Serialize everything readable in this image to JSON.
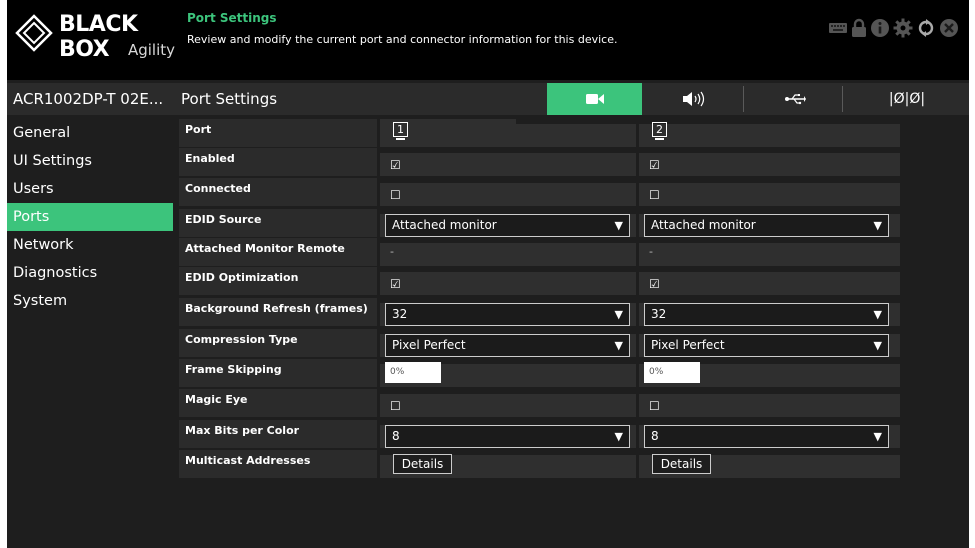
{
  "header": {
    "brand": "BLACK BOX",
    "product": "Agility",
    "title": "Port Settings",
    "description": "Review and modify the current port and connector information for this device.",
    "icons": [
      "keyboard-icon",
      "lock-icon",
      "info-icon",
      "settings-icon",
      "refresh-icon",
      "close-icon"
    ]
  },
  "device": {
    "name": "ACR1002DP-T 02E..."
  },
  "nav": {
    "items": [
      "General",
      "UI Settings",
      "Users",
      "Ports",
      "Network",
      "Diagnostics",
      "System"
    ],
    "active": "Ports"
  },
  "section": {
    "title": "Port Settings",
    "tabs": [
      {
        "icon": "video-camera-icon",
        "active": true
      },
      {
        "icon": "speaker-icon",
        "active": false
      },
      {
        "icon": "usb-icon",
        "active": false
      },
      {
        "icon": "serial-icon",
        "label": "|Ø|Ø|",
        "active": false
      }
    ]
  },
  "table": {
    "labels": {
      "port": "Port",
      "enabled": "Enabled",
      "connected": "Connected",
      "edid_source": "EDID Source",
      "attached_monitor_remote": "Attached Monitor Remote",
      "edid_optimization": "EDID Optimization",
      "background_refresh": "Background Refresh (frames)",
      "compression_type": "Compression Type",
      "frame_skipping": "Frame Skipping",
      "magic_eye": "Magic Eye",
      "max_bits_per_color": "Max Bits per Color",
      "multicast_addresses": "Multicast Addresses"
    },
    "ports": [
      {
        "number": "1",
        "enabled": true,
        "enabled_glyph": "☑",
        "connected": false,
        "connected_glyph": "☐",
        "edid_source": "Attached monitor",
        "attached_monitor_remote": "-",
        "edid_optimization": true,
        "edid_optimization_glyph": "☑",
        "background_refresh": "32",
        "compression_type": "Pixel Perfect",
        "frame_skipping": "0%",
        "magic_eye": false,
        "magic_eye_glyph": "☐",
        "max_bits_per_color": "8",
        "details_label": "Details"
      },
      {
        "number": "2",
        "enabled": true,
        "enabled_glyph": "☑",
        "connected": false,
        "connected_glyph": "☐",
        "edid_source": "Attached monitor",
        "attached_monitor_remote": "-",
        "edid_optimization": true,
        "edid_optimization_glyph": "☑",
        "background_refresh": "32",
        "compression_type": "Pixel Perfect",
        "frame_skipping": "0%",
        "magic_eye": false,
        "magic_eye_glyph": "☐",
        "max_bits_per_color": "8",
        "details_label": "Details"
      }
    ],
    "dropdown_arrow": "▼"
  },
  "colors": {
    "accent": "#3cc47c",
    "header_bg": "#000000",
    "panel_bg": "#1e1e1e",
    "row_bg": "#2b2b2b"
  }
}
